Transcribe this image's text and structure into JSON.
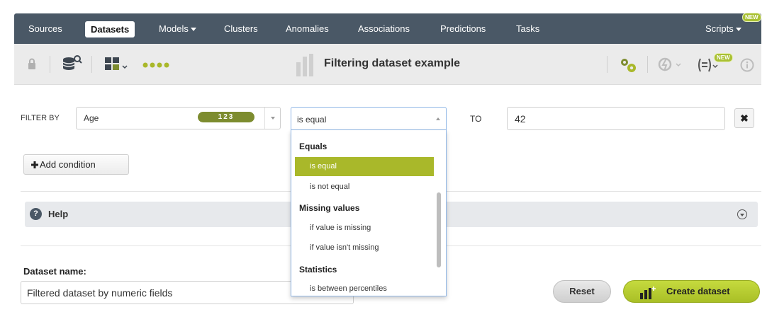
{
  "nav": {
    "items": [
      {
        "label": "Sources"
      },
      {
        "label": "Datasets"
      },
      {
        "label": "Models"
      },
      {
        "label": "Clusters"
      },
      {
        "label": "Anomalies"
      },
      {
        "label": "Associations"
      },
      {
        "label": "Predictions"
      },
      {
        "label": "Tasks"
      },
      {
        "label": "Scripts"
      }
    ],
    "new_badge": "NEW"
  },
  "toolbar": {
    "title": "Filtering dataset example",
    "new_badge": "NEW",
    "icons": [
      "lock-icon",
      "dataset-search-icon",
      "fields-menu-icon",
      "pagination-dots-icon",
      "dataset-bars-icon",
      "configure-gears-icon",
      "one-click-actions-icon",
      "filter-formula-icon",
      "info-icon"
    ]
  },
  "filter": {
    "label": "FILTER BY",
    "field": "Age",
    "field_type_badge": "123",
    "operator": "is equal",
    "to_label": "TO",
    "value": "42",
    "remove_glyph": "✖"
  },
  "add_condition": {
    "label": "Add condition"
  },
  "dropdown": {
    "groups": [
      {
        "label": "Equals",
        "items": [
          {
            "label": "is equal",
            "selected": true
          },
          {
            "label": "is not equal",
            "selected": false
          }
        ]
      },
      {
        "label": "Missing values",
        "items": [
          {
            "label": "if value is missing",
            "selected": false
          },
          {
            "label": "if value isn't missing",
            "selected": false
          }
        ]
      },
      {
        "label": "Statistics",
        "items": [
          {
            "label": "is between percentiles",
            "selected": false
          }
        ]
      }
    ]
  },
  "help": {
    "label": "Help"
  },
  "dataset_name": {
    "label": "Dataset name:",
    "value": "Filtered dataset by numeric fields"
  },
  "actions": {
    "reset": "Reset",
    "create": "Create dataset"
  },
  "colors": {
    "nav_bg": "#4a5866",
    "accent_green": "#a9b82a",
    "badge_green": "#7d8c2f"
  }
}
